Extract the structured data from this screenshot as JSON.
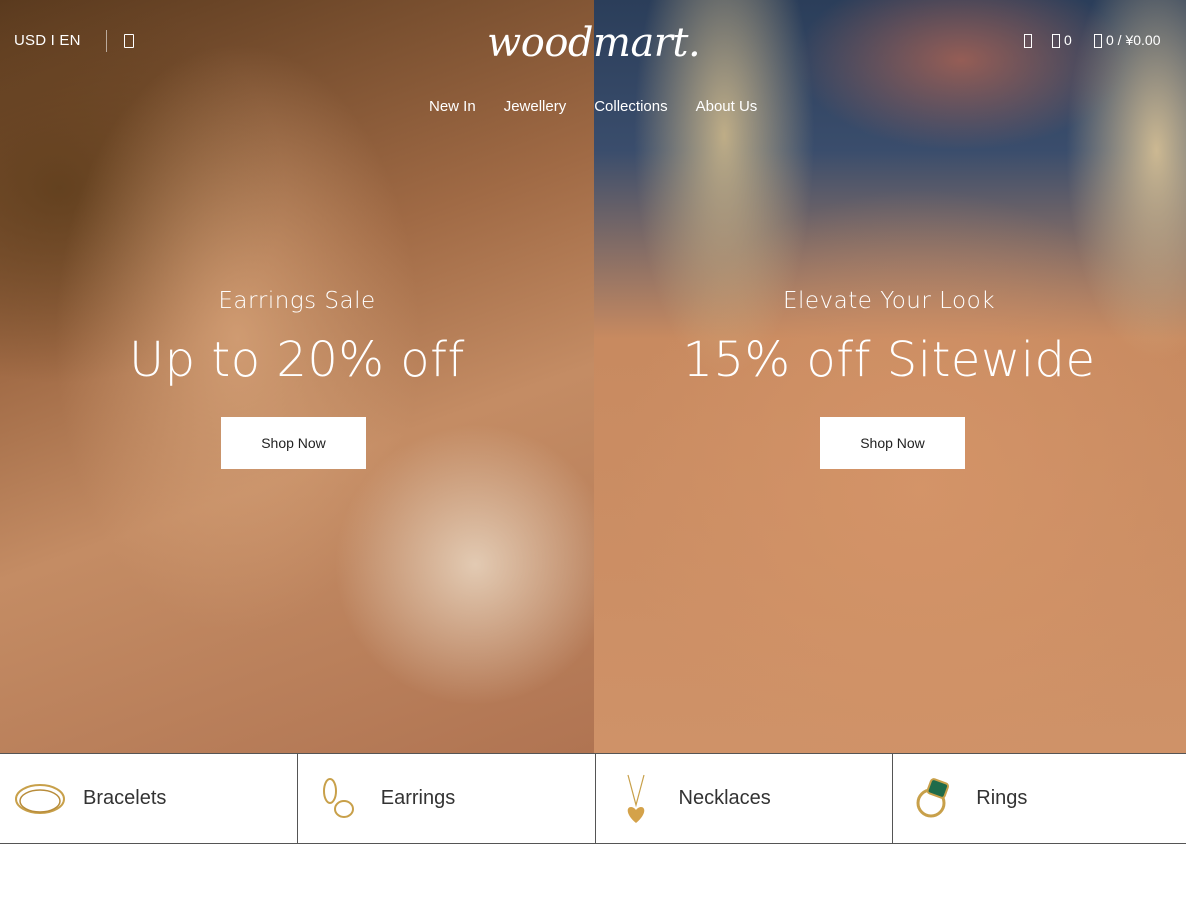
{
  "header": {
    "currency_lang": "USD I EN",
    "logo_text": "woodmart.",
    "nav": [
      "New In",
      "Jewellery",
      "Collections",
      "About Us"
    ],
    "compare_count": "0",
    "cart_summary": "0 / ¥0.00"
  },
  "hero": {
    "left": {
      "subtitle": "Earrings Sale",
      "title": "Up to 20% off",
      "button": "Shop Now"
    },
    "right": {
      "subtitle": "Elevate Your Look",
      "title": "15% off Sitewide",
      "button": "Shop Now"
    }
  },
  "categories": [
    {
      "label": "Bracelets",
      "icon": "bracelet-icon"
    },
    {
      "label": "Earrings",
      "icon": "earrings-icon"
    },
    {
      "label": "Necklaces",
      "icon": "necklace-icon"
    },
    {
      "label": "Rings",
      "icon": "ring-icon"
    }
  ],
  "colors": {
    "accent": "#ffffff",
    "text_dark": "#333333",
    "gold": "#c8a04a",
    "emerald": "#1e6b4a"
  }
}
